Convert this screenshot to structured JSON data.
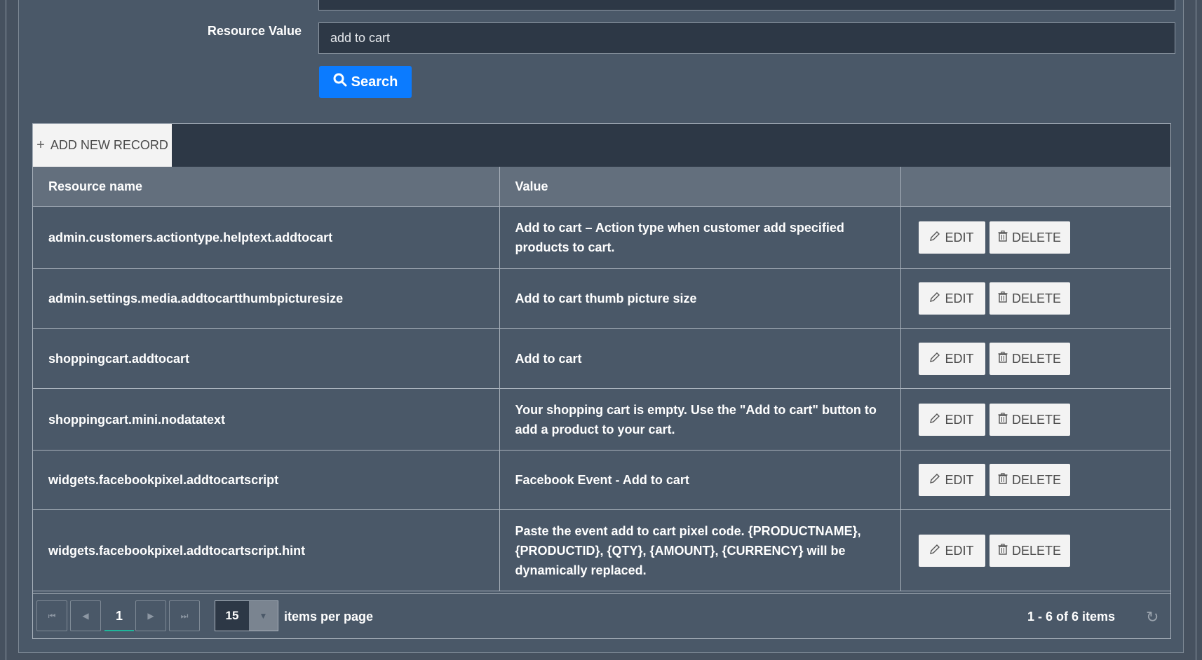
{
  "filter": {
    "resource_value_label": "Resource Value",
    "resource_value": "add to cart",
    "search_label": "Search"
  },
  "grid": {
    "add_new_label": "ADD NEW RECORD",
    "columns": [
      "Resource name",
      "Value",
      ""
    ],
    "rows": [
      {
        "name": "admin.customers.actiontype.helptext.addtocart",
        "value": "Add to cart – Action type when customer add specified products to cart."
      },
      {
        "name": "admin.settings.media.addtocartthumbpicturesize",
        "value": "Add to cart thumb picture size"
      },
      {
        "name": "shoppingcart.addtocart",
        "value": "Add to cart"
      },
      {
        "name": "shoppingcart.mini.nodatatext",
        "value": "Your shopping cart is empty. Use the \"Add to cart\" button to add a product to your cart."
      },
      {
        "name": "widgets.facebookpixel.addtocartscript",
        "value": "Facebook Event - Add to cart"
      },
      {
        "name": "widgets.facebookpixel.addtocartscript.hint",
        "value": "Paste the event add to cart pixel code. {PRODUCTNAME}, {PRODUCTID}, {QTY}, {AMOUNT}, {CURRENCY} will be dynamically replaced."
      }
    ],
    "edit_label": "EDIT",
    "delete_label": "DELETE"
  },
  "pager": {
    "current_page": "1",
    "page_size": "15",
    "items_per_page_label": "items per page",
    "range_info": "1 - 6 of 6 items"
  }
}
